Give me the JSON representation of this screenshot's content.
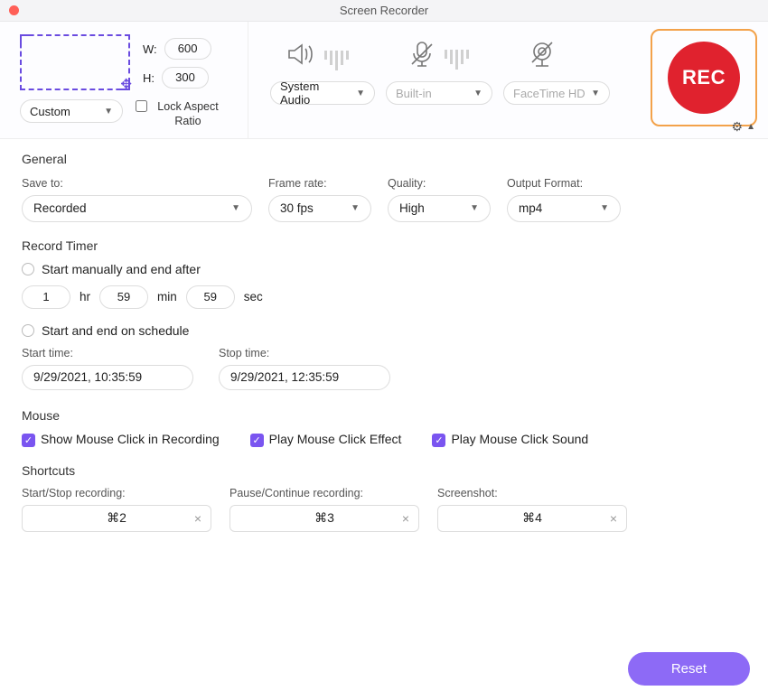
{
  "titlebar": {
    "title": "Screen Recorder"
  },
  "capture": {
    "w_label": "W:",
    "h_label": "H:",
    "width": "600",
    "height": "300",
    "preset": "Custom",
    "lock_aspect": "Lock Aspect Ratio"
  },
  "sources": {
    "audio": "System Audio",
    "mic": "Built-in",
    "camera": "FaceTime HD"
  },
  "rec_label": "REC",
  "general": {
    "title": "General",
    "save_to_label": "Save to:",
    "save_to": "Recorded",
    "fps_label": "Frame rate:",
    "fps": "30 fps",
    "quality_label": "Quality:",
    "quality": "High",
    "format_label": "Output Format:",
    "format": "mp4"
  },
  "timer": {
    "title": "Record Timer",
    "opt_manual": "Start manually and end after",
    "hr": "1",
    "hr_label": "hr",
    "min": "59",
    "min_label": "min",
    "sec": "59",
    "sec_label": "sec",
    "opt_sched": "Start and end on schedule",
    "start_label": "Start time:",
    "stop_label": "Stop time:",
    "start_time": "9/29/2021, 10:35:59",
    "stop_time": "9/29/2021, 12:35:59"
  },
  "mouse": {
    "title": "Mouse",
    "show_click": "Show Mouse Click in Recording",
    "play_effect": "Play Mouse Click Effect",
    "play_sound": "Play Mouse Click Sound"
  },
  "shortcuts": {
    "title": "Shortcuts",
    "startstop_label": "Start/Stop recording:",
    "startstop": "⌘2",
    "pause_label": "Pause/Continue recording:",
    "pause": "⌘3",
    "screenshot_label": "Screenshot:",
    "screenshot": "⌘4"
  },
  "reset": "Reset"
}
